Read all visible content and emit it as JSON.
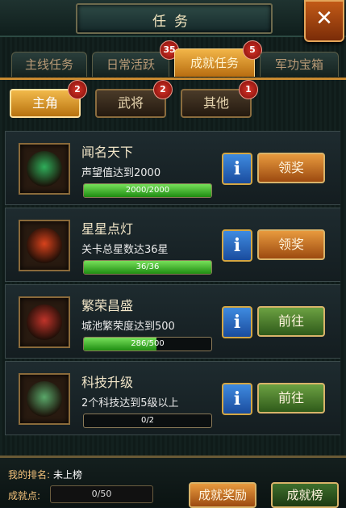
{
  "header": {
    "title": "任务",
    "close_label": "✕"
  },
  "tabs": [
    {
      "label": "主线任务",
      "badge": ""
    },
    {
      "label": "日常活跃",
      "badge": "35"
    },
    {
      "label": "成就任务",
      "badge": "5"
    },
    {
      "label": "军功宝箱",
      "badge": ""
    }
  ],
  "subtabs": [
    {
      "label": "主角",
      "badge": "2"
    },
    {
      "label": "武将",
      "badge": "2"
    },
    {
      "label": "其他",
      "badge": "1"
    }
  ],
  "achievements": [
    {
      "title": "闻名天下",
      "desc": "声望值达到2000",
      "progress_text": "2000/2000",
      "progress": 1.0,
      "action": "领奖",
      "action_style": "orange",
      "gem_color": "#2fae5a"
    },
    {
      "title": "星星点灯",
      "desc": "关卡总星数达36星",
      "progress_text": "36/36",
      "progress": 1.0,
      "action": "领奖",
      "action_style": "orange",
      "gem_color": "#d8421c"
    },
    {
      "title": "繁荣昌盛",
      "desc": "城池繁荣度达到500",
      "progress_text": "286/500",
      "progress": 0.57,
      "action": "前往",
      "action_style": "green",
      "gem_color": "#c0342a"
    },
    {
      "title": "科技升级",
      "desc": "2个科技达到5级以上",
      "progress_text": "0/2",
      "progress": 0.0,
      "action": "前往",
      "action_style": "green",
      "gem_color": "#5aa86a"
    }
  ],
  "info_label": "i",
  "footer": {
    "rank_label": "我的排名:",
    "rank_value": "未上榜",
    "points_label": "成就点:",
    "points_value": "0/50",
    "reward_button": "成就奖励",
    "ranking_button": "成就榜"
  }
}
